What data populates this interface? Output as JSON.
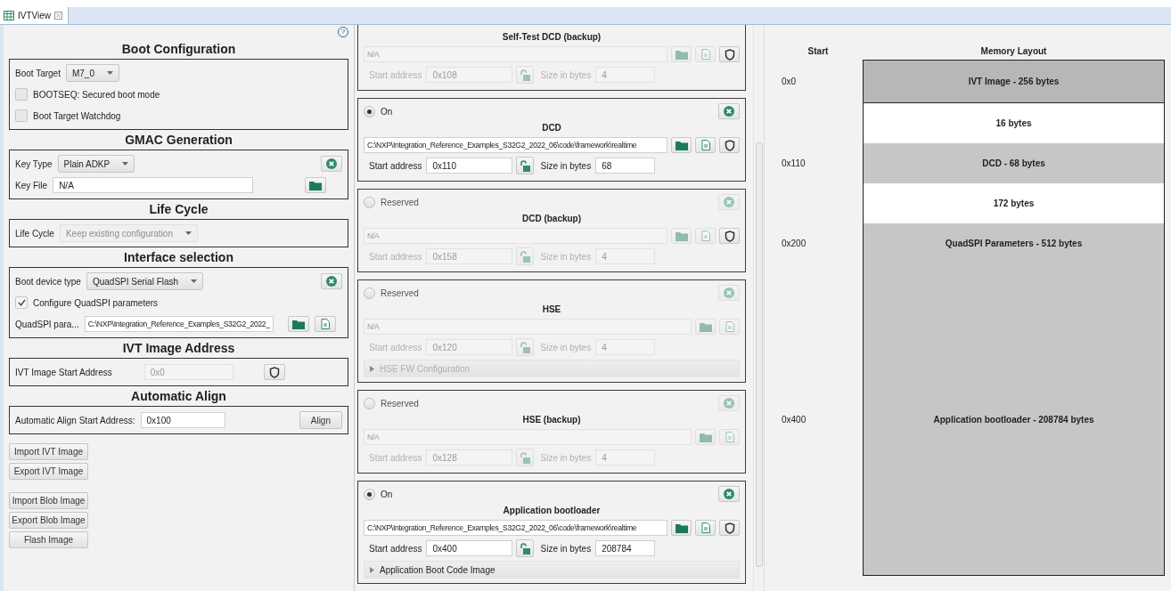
{
  "tab": {
    "label": "IVTView",
    "selected": true
  },
  "help": {
    "label": "?"
  },
  "config": {
    "sections": [
      {
        "title": "Boot Configuration",
        "items": [
          {
            "kind": "combo",
            "label": "Boot Target",
            "value": "M7_0",
            "disabled": false
          },
          {
            "kind": "checkbox",
            "label": "BOOTSEQ: Secured boot mode",
            "checked": false
          },
          {
            "kind": "checkbox",
            "label": "Boot Target Watchdog",
            "checked": false
          }
        ]
      },
      {
        "title": "GMAC Generation",
        "items": [
          {
            "kind": "combo",
            "label": "Key Type",
            "value": "Plain ADKP",
            "disabled": false,
            "actions": [
              {
                "kind": "remove"
              }
            ]
          },
          {
            "kind": "field",
            "label": "Key File",
            "value": "N/A",
            "disabled": false,
            "actions": [
              {
                "kind": "folder"
              }
            ]
          }
        ]
      },
      {
        "title": "Life Cycle",
        "items": [
          {
            "kind": "combo",
            "label": "Life Cycle",
            "value": "Keep existing configuration",
            "disabled": true
          }
        ]
      },
      {
        "title": "Interface selection",
        "items": [
          {
            "kind": "combo",
            "label": "Boot device type",
            "value": "QuadSPI Serial Flash",
            "disabled": false,
            "actions": [
              {
                "kind": "remove"
              }
            ]
          },
          {
            "kind": "checkbox",
            "label": "Configure QuadSPI parameters",
            "checked": true
          },
          {
            "kind": "field",
            "label": "QuadSPI para...",
            "value": "C:\\NXP\\Integration_Reference_Examples_S32G2_2022_",
            "disabled": false,
            "actions": [
              {
                "kind": "folder"
              },
              {
                "kind": "file"
              }
            ]
          }
        ]
      },
      {
        "title": "IVT Image Address",
        "items": [
          {
            "kind": "field",
            "label": "IVT Image Start Address",
            "value": "0x0",
            "disabled": true,
            "actions": [
              {
                "kind": "shield"
              }
            ]
          }
        ]
      },
      {
        "title": "Automatic Align",
        "items": [
          {
            "kind": "field",
            "label": "Automatic Align Start Address:",
            "value": "0x100",
            "disabled": false,
            "actions": [
              {
                "kind": "button",
                "label": "Align"
              }
            ]
          }
        ]
      }
    ],
    "button_groups": [
      [
        "Import IVT Image",
        "Export IVT Image"
      ],
      [
        "Import Blob Image",
        "Export Blob Image",
        "Flash Image"
      ]
    ]
  },
  "images": [
    {
      "title": "Self-Test DCD (backup)",
      "path": "N/A",
      "start_label": "Start address",
      "start": "0x108",
      "size_label": "Size in bytes",
      "size": "4",
      "enabled": false,
      "actions": [
        {
          "kind": "folder"
        },
        {
          "kind": "file"
        },
        {
          "kind": "shield"
        }
      ]
    },
    {
      "radio": {
        "label": "On",
        "selected": true
      },
      "title": "DCD",
      "path": "C:\\NXP\\Integration_Reference_Examples_S32G2_2022_06\\code\\framework\\realtime",
      "start_label": "Start address",
      "start": "0x110",
      "size_label": "Size in bytes",
      "size": "68",
      "enabled": true,
      "actions": [
        {
          "kind": "folder"
        },
        {
          "kind": "file"
        },
        {
          "kind": "shield"
        }
      ]
    },
    {
      "radio": {
        "label": "Reserved",
        "selected": false
      },
      "title": "DCD (backup)",
      "path": "N/A",
      "start_label": "Start address",
      "start": "0x158",
      "size_label": "Size in bytes",
      "size": "4",
      "enabled": false,
      "actions": [
        {
          "kind": "folder"
        },
        {
          "kind": "file"
        },
        {
          "kind": "shield"
        }
      ]
    },
    {
      "radio": {
        "label": "Reserved",
        "selected": false
      },
      "title": "HSE",
      "path": "N/A",
      "start_label": "Start address",
      "start": "0x120",
      "size_label": "Size in bytes",
      "size": "4",
      "enabled": false,
      "actions": [
        {
          "kind": "folder"
        },
        {
          "kind": "file"
        }
      ],
      "expander": {
        "label": "HSE FW Configuration",
        "expanded": false
      }
    },
    {
      "radio": {
        "label": "Reserved",
        "selected": false
      },
      "title": "HSE (backup)",
      "path": "N/A",
      "start_label": "Start address",
      "start": "0x128",
      "size_label": "Size in bytes",
      "size": "4",
      "enabled": false,
      "actions": [
        {
          "kind": "folder"
        },
        {
          "kind": "file"
        }
      ]
    },
    {
      "radio": {
        "label": "On",
        "selected": true
      },
      "title": "Application bootloader",
      "path": "C:\\NXP\\Integration_Reference_Examples_S32G2_2022_06\\code\\framework\\realtime",
      "start_label": "Start address",
      "start": "0x400",
      "size_label": "Size in bytes",
      "size": "208784",
      "enabled": true,
      "actions": [
        {
          "kind": "folder"
        },
        {
          "kind": "file"
        },
        {
          "kind": "shield"
        }
      ],
      "expander": {
        "label": "Application Boot Code Image",
        "expanded": false
      }
    }
  ],
  "memory": {
    "start_header": "Start",
    "layout_header": "Memory Layout",
    "blocks": [
      {
        "start": "0x0",
        "label": "IVT Image - 256 bytes",
        "kind": "used",
        "selected": true
      },
      {
        "label": "16 bytes",
        "kind": "free",
        "selected": false
      },
      {
        "start": "0x110",
        "label": "DCD - 68 bytes",
        "kind": "used",
        "selected": false
      },
      {
        "label": "172 bytes",
        "kind": "free",
        "selected": false
      },
      {
        "start": "0x200",
        "label": "QuadSPI Parameters - 512 bytes",
        "kind": "used",
        "selected": false
      },
      {
        "start": "0x400",
        "label": "Application bootloader - 208784 bytes",
        "kind": "used",
        "selected": false
      }
    ]
  }
}
